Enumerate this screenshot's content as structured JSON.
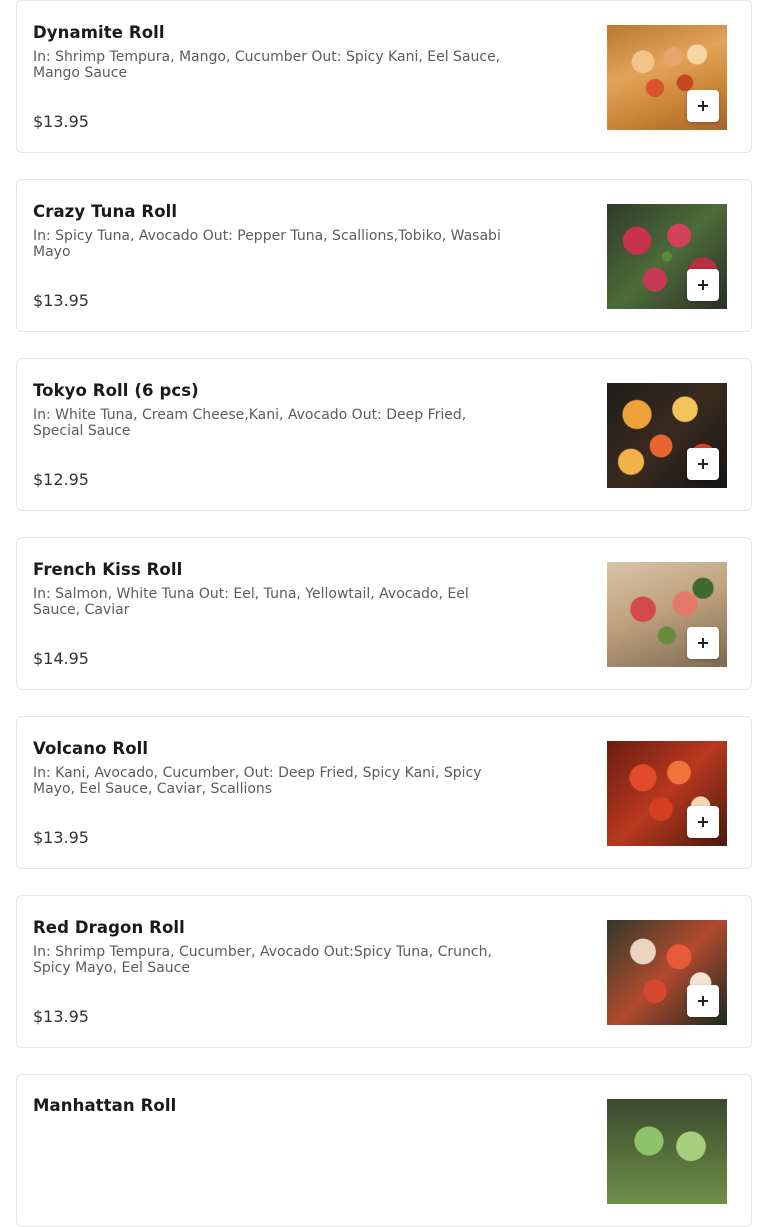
{
  "menu_items": [
    {
      "name": "Dynamite Roll",
      "description": "In: Shrimp Tempura, Mango, Cucumber Out: Spicy Kani, Eel Sauce, Mango Sauce",
      "price": "$13.95",
      "image_icon": "sushi-roll-photo"
    },
    {
      "name": "Crazy Tuna Roll",
      "description": "In: Spicy Tuna, Avocado Out: Pepper Tuna, Scallions,Tobiko, Wasabi Mayo",
      "price": "$13.95",
      "image_icon": "sushi-roll-photo"
    },
    {
      "name": "Tokyo Roll (6 pcs)",
      "description": "In: White Tuna, Cream Cheese,Kani, Avocado Out: Deep Fried, Special Sauce",
      "price": "$12.95",
      "image_icon": "sushi-roll-photo"
    },
    {
      "name": "French Kiss Roll",
      "description": "In: Salmon, White Tuna Out: Eel, Tuna, Yellowtail, Avocado, Eel Sauce, Caviar",
      "price": "$14.95",
      "image_icon": "sushi-roll-photo"
    },
    {
      "name": "Volcano Roll",
      "description": "In: Kani, Avocado, Cucumber, Out: Deep Fried, Spicy Kani, Spicy Mayo, Eel Sauce, Caviar, Scallions",
      "price": "$13.95",
      "image_icon": "sushi-roll-photo"
    },
    {
      "name": "Red Dragon Roll",
      "description": "In: Shrimp Tempura, Cucumber, Avocado Out:Spicy Tuna, Crunch, Spicy Mayo, Eel Sauce",
      "price": "$13.95",
      "image_icon": "sushi-roll-photo"
    },
    {
      "name": "Manhattan Roll",
      "image_icon": "sushi-roll-photo"
    }
  ],
  "add_button_icon": "plus-icon",
  "colors": {
    "card_border": "#e6e6e6",
    "title_text": "#1a1a1a",
    "description_text": "#5c5c5c",
    "price_text": "#333333"
  }
}
